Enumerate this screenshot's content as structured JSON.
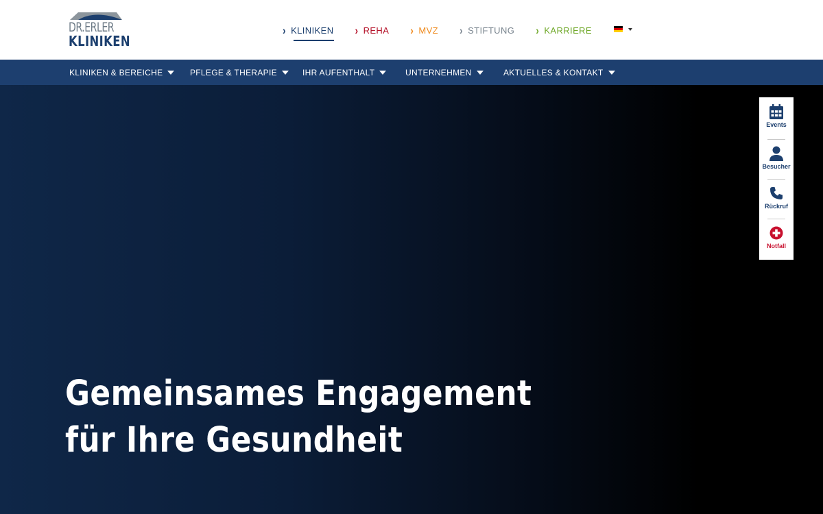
{
  "logo": {
    "line1": "DR.ERLER",
    "line2": "KLINIKEN"
  },
  "brand_nav": [
    {
      "label": "KLINIKEN",
      "color": "#1c3f6e",
      "active": true
    },
    {
      "label": "REHA",
      "color": "#b5132a"
    },
    {
      "label": "MVZ",
      "color": "#ef8a1e"
    },
    {
      "label": "STIFTUNG",
      "color": "#7b8690"
    },
    {
      "label": "KARRIERE",
      "color": "#71a92b"
    }
  ],
  "language": {
    "icon": "german-flag-icon"
  },
  "main_nav": [
    {
      "label": "KLINIKEN & BEREICHE"
    },
    {
      "label": "PFLEGE & THERAPIE"
    },
    {
      "label": "IHR AUFENTHALT"
    },
    {
      "label": "UNTERNEHMEN"
    },
    {
      "label": "AKTUELLES & KONTAKT"
    }
  ],
  "hero": {
    "title_line1": "Gemeinsames Engagement",
    "title_line2": "für Ihre Gesundheit"
  },
  "quick_links": [
    {
      "label": "Events",
      "icon": "calendar-icon"
    },
    {
      "label": "Besucher",
      "icon": "user-icon"
    },
    {
      "label": "Rückruf",
      "icon": "phone-icon"
    },
    {
      "label": "Notfall",
      "icon": "emergency-plus-icon"
    }
  ],
  "colors": {
    "primary": "#1d3f6f",
    "emergency": "#c8102e"
  }
}
